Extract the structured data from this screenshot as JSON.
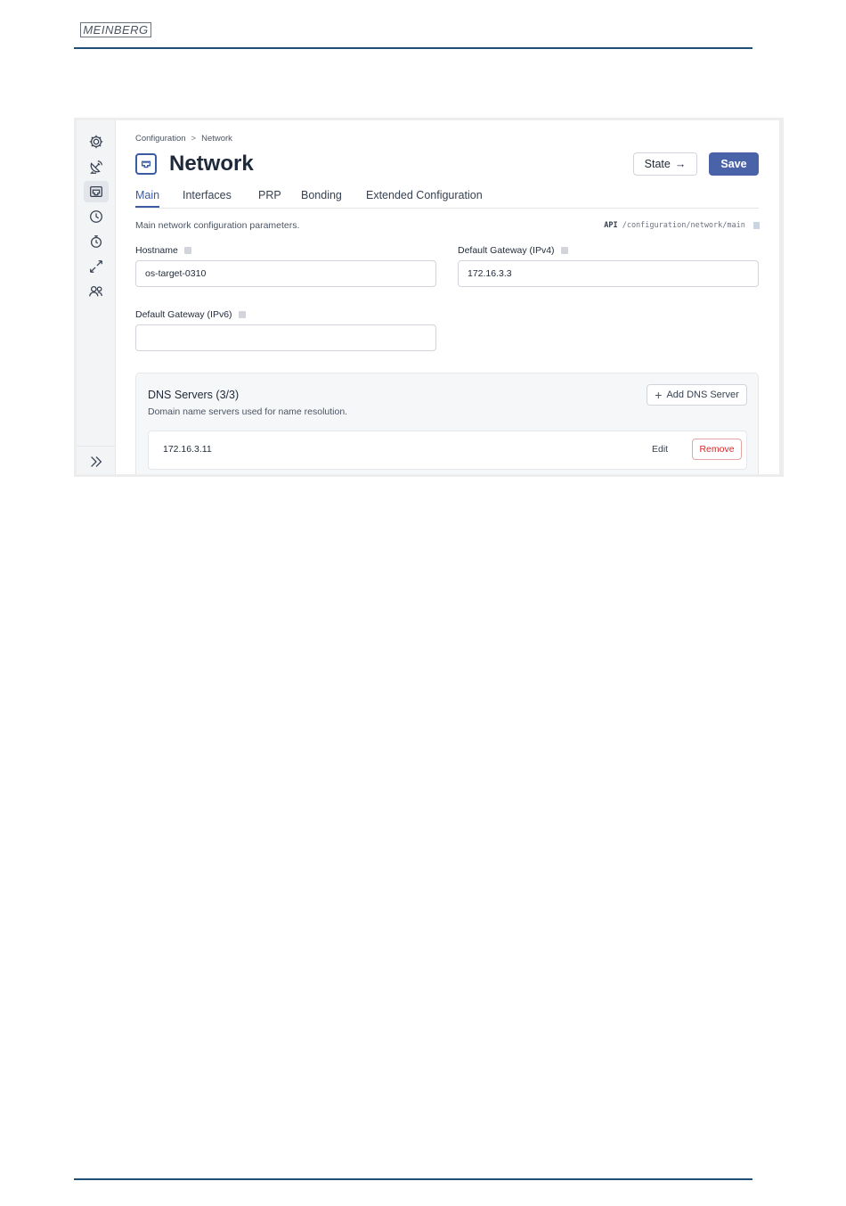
{
  "document": {
    "logo_text": "MEINBERG"
  },
  "sidebar": {
    "items": [
      {
        "icon": "gear-icon"
      },
      {
        "icon": "satellite-dish-icon"
      },
      {
        "icon": "network-port-icon",
        "active": true
      },
      {
        "icon": "clock-icon"
      },
      {
        "icon": "stopwatch-icon"
      },
      {
        "icon": "arrows-diagonal-icon"
      },
      {
        "icon": "users-icon"
      }
    ],
    "expand_icon": "chevrons-right-icon"
  },
  "breadcrumb": {
    "items": [
      "Configuration",
      "Network"
    ],
    "separator": ">"
  },
  "header": {
    "title": "Network",
    "state_button": "State",
    "state_arrow": "→",
    "save_button": "Save"
  },
  "tabs": [
    {
      "label": "Main",
      "active": true
    },
    {
      "label": "Interfaces"
    },
    {
      "label": "PRP"
    },
    {
      "label": "Bonding"
    },
    {
      "label": "Extended Configuration"
    }
  ],
  "section": {
    "description": "Main network configuration parameters.",
    "api_label": "API",
    "api_path": "/configuration/network/main"
  },
  "fields": {
    "hostname": {
      "label": "Hostname",
      "value": "os-target-0310"
    },
    "gateway_ipv4": {
      "label": "Default Gateway (IPv4)",
      "value": "172.16.3.3"
    },
    "gateway_ipv6": {
      "label": "Default Gateway (IPv6)",
      "value": ""
    }
  },
  "dns": {
    "title": "DNS Servers (3/3)",
    "description": "Domain name servers used for name resolution.",
    "add_button": "Add DNS Server",
    "servers": [
      {
        "address": "172.16.3.11",
        "edit_label": "Edit",
        "remove_label": "Remove"
      }
    ]
  },
  "colors": {
    "accent": "#3b5ba5",
    "save_bg": "#4a62a8",
    "danger": "#dc2626",
    "rule": "#1f4e79"
  }
}
